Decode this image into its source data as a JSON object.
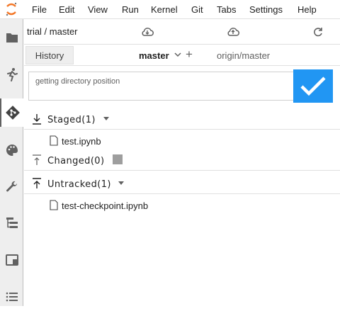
{
  "menubar": {
    "items": [
      "File",
      "Edit",
      "View",
      "Run",
      "Kernel",
      "Git",
      "Tabs",
      "Settings",
      "Help"
    ]
  },
  "sidebar": {
    "icons": [
      "folder-icon",
      "running-icon",
      "git-icon",
      "palette-icon",
      "wrench-icon",
      "tree-icon",
      "window-icon",
      "list-icon"
    ],
    "active": "git-icon"
  },
  "git": {
    "repo_path": "trial / master",
    "toolbar_icons": [
      "cloud-download-icon",
      "cloud-upload-icon",
      "refresh-icon"
    ],
    "history_tab": "History",
    "current_branch": "master",
    "remote_branch": "origin/master",
    "commit_message": "getting directory position",
    "commit_color": "#2196f3",
    "sections": {
      "staged": {
        "title": "Staged(1)",
        "files": [
          "test.ipynb"
        ]
      },
      "changed": {
        "title": "Changed(0)",
        "files": []
      },
      "untracked": {
        "title": "Untracked(1)",
        "files": [
          "test-checkpoint.ipynb"
        ]
      }
    }
  }
}
